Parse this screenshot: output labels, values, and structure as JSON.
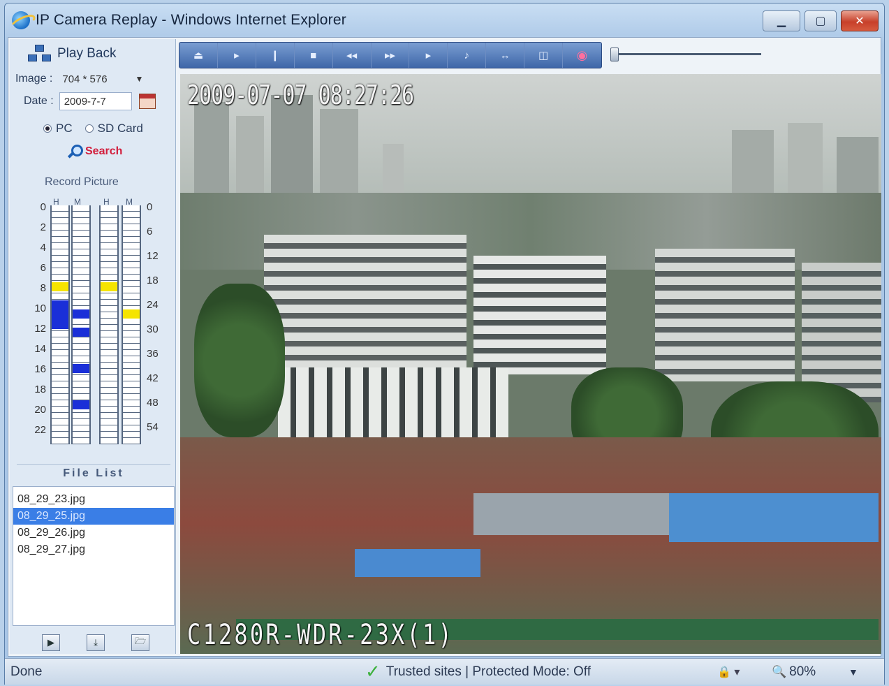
{
  "window": {
    "title": "IP Camera Replay - Windows Internet Explorer"
  },
  "left_panel": {
    "heading": "Play Back",
    "image_label": "Image :",
    "image_value": "704 * 576",
    "date_label": "Date :",
    "date_value": "2009-7-7",
    "radio_pc": "PC",
    "radio_sd": "SD Card",
    "radio_selected": "PC",
    "search_label": "Search",
    "record_title": "Record Picture",
    "col_h": "H",
    "col_m": "M",
    "hour_ticks": [
      "0",
      "2",
      "4",
      "6",
      "8",
      "10",
      "12",
      "14",
      "16",
      "18",
      "20",
      "22"
    ],
    "minute_ticks": [
      "0",
      "6",
      "12",
      "18",
      "24",
      "30",
      "36",
      "42",
      "48",
      "54"
    ],
    "marks": [
      {
        "track": "H1",
        "slot": 8,
        "span": 1,
        "color": "#f5e400"
      },
      {
        "track": "H1",
        "slot": 10,
        "span": 3,
        "color": "#1a2fd8"
      },
      {
        "track": "M1",
        "slot": 11,
        "span": 1,
        "color": "#1a2fd8"
      },
      {
        "track": "M1",
        "slot": 13,
        "span": 1,
        "color": "#1a2fd8"
      },
      {
        "track": "M1",
        "slot": 17,
        "span": 1,
        "color": "#1a2fd8"
      },
      {
        "track": "M1",
        "slot": 21,
        "span": 1,
        "color": "#1a2fd8"
      },
      {
        "track": "H2",
        "slot": 8,
        "span": 1,
        "color": "#f5e400"
      },
      {
        "track": "M2",
        "slot": 11,
        "span": 1,
        "color": "#f5e400"
      }
    ],
    "file_list_title": "File List",
    "files": [
      "08_29_23.jpg",
      "08_29_25.jpg",
      "08_29_26.jpg",
      "08_29_27.jpg"
    ],
    "selected_file_index": 1
  },
  "toolbar": {
    "buttons": [
      "open-icon",
      "play-icon",
      "pause-icon",
      "stop-icon",
      "rewind-icon",
      "fast-forward-icon",
      "next-icon",
      "volume-icon",
      "zoom-icon",
      "snapshot-icon",
      "record-icon"
    ],
    "glyphs": [
      "⏏",
      "▸",
      "❙",
      "■",
      "◂◂",
      "▸▸",
      "▸",
      "♪",
      "↔",
      "◫",
      "◉"
    ]
  },
  "video": {
    "timestamp": "2009-07-07 08:27:26",
    "camera_label": "C1280R-WDR-23X(1)"
  },
  "statusbar": {
    "status": "Done",
    "zone": "Trusted sites | Protected Mode: Off",
    "zoom": "80%"
  }
}
